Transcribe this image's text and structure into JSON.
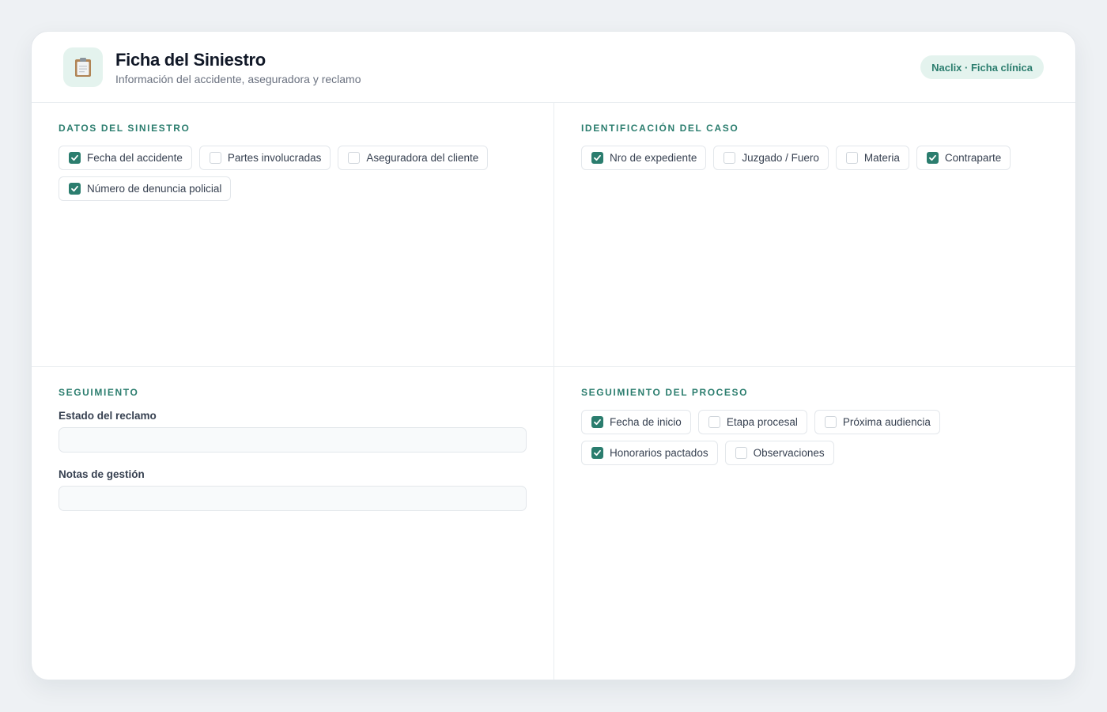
{
  "header": {
    "title": "Ficha del Siniestro",
    "subtitle": "Información del accidente, aseguradora y reclamo",
    "icon": "clipboard-icon",
    "badge": "Naclix · Ficha clínica"
  },
  "colors": {
    "accent": "#2b7d6e",
    "accent_soft": "#e4f3ee",
    "background": "#eef1f4"
  },
  "sections": {
    "datos_siniestro": {
      "title": "DATOS DEL SINIESTRO",
      "items": [
        {
          "label": "Fecha del accidente",
          "checked": true
        },
        {
          "label": "Partes involucradas",
          "checked": false
        },
        {
          "label": "Aseguradora del cliente",
          "checked": false
        },
        {
          "label": "Número de denuncia policial",
          "checked": true
        }
      ]
    },
    "identificacion": {
      "title": "IDENTIFICACIÓN DEL CASO",
      "items": [
        {
          "label": "Nro de expediente",
          "checked": true
        },
        {
          "label": "Juzgado / Fuero",
          "checked": false
        },
        {
          "label": "Materia",
          "checked": false
        },
        {
          "label": "Contraparte",
          "checked": true
        }
      ]
    },
    "seguimiento": {
      "title": "SEGUIMIENTO",
      "estado_label": "Estado del reclamo",
      "estado_value": "",
      "notas_label": "Notas de gestión",
      "notas_value": ""
    },
    "seguimiento_proceso": {
      "title": "SEGUIMIENTO DEL PROCESO",
      "items": [
        {
          "label": "Fecha de inicio",
          "checked": true
        },
        {
          "label": "Etapa procesal",
          "checked": false
        },
        {
          "label": "Próxima audiencia",
          "checked": false
        },
        {
          "label": "Honorarios pactados",
          "checked": true
        },
        {
          "label": "Observaciones",
          "checked": false
        }
      ]
    }
  }
}
